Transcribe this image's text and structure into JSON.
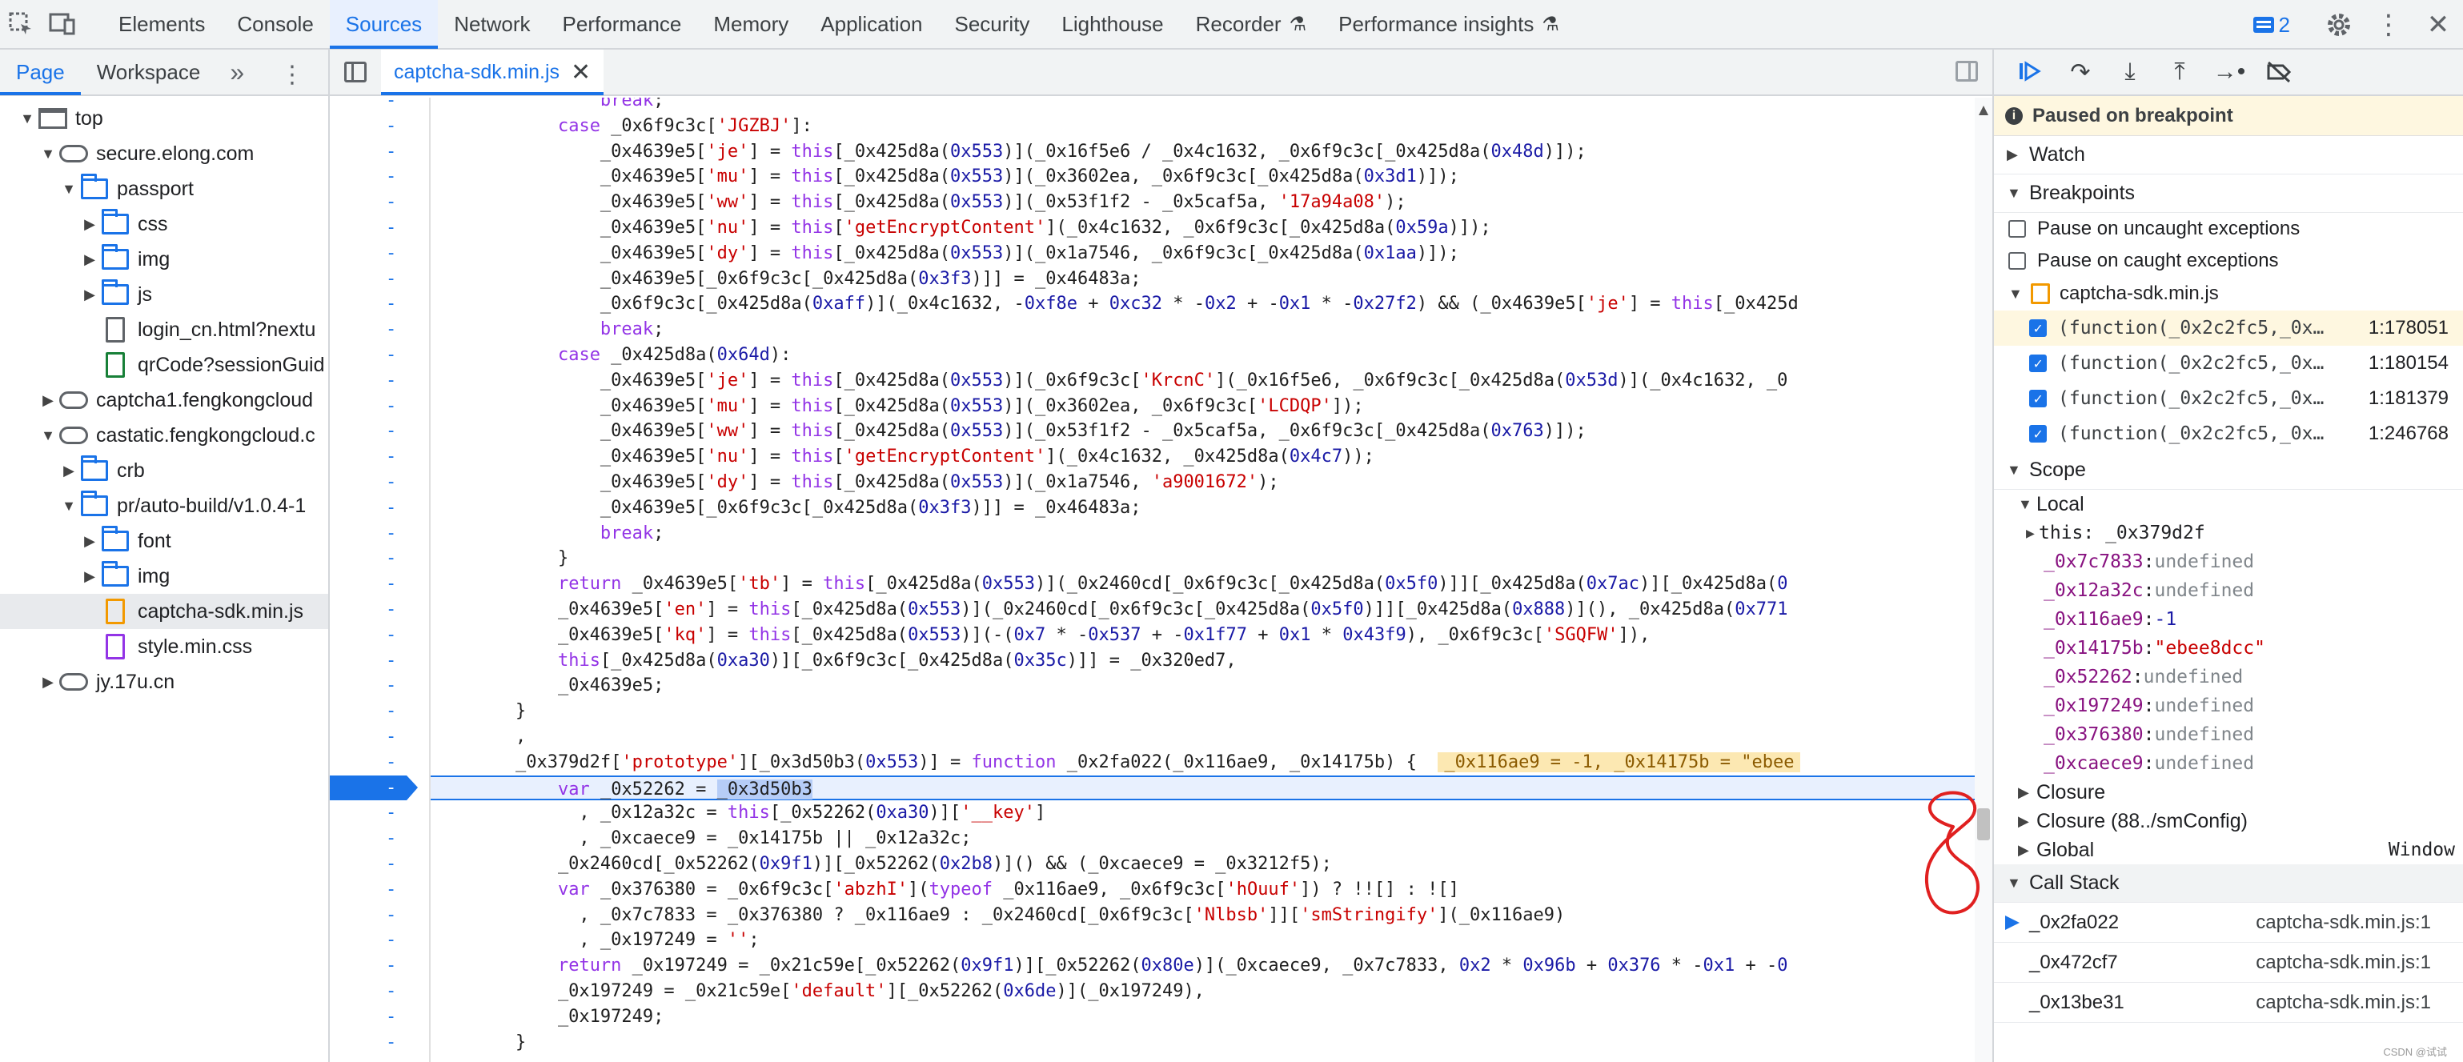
{
  "toolbar": {
    "tabs": [
      "Elements",
      "Console",
      "Sources",
      "Network",
      "Performance",
      "Memory",
      "Application",
      "Security",
      "Lighthouse",
      "Recorder",
      "Performance insights"
    ],
    "active_tab": "Sources",
    "issues_count": "2"
  },
  "navigator": {
    "tabs": [
      "Page",
      "Workspace"
    ],
    "tree": [
      {
        "label": "top",
        "icon": "frame"
      },
      {
        "label": "secure.elong.com",
        "icon": "cloud"
      },
      {
        "label": "passport",
        "icon": "folder"
      },
      {
        "label": "css",
        "icon": "folder"
      },
      {
        "label": "img",
        "icon": "folder"
      },
      {
        "label": "js",
        "icon": "folder"
      },
      {
        "label": "login_cn.html?nextu",
        "icon": "file"
      },
      {
        "label": "qrCode?sessionGuid",
        "icon": "file-green"
      },
      {
        "label": "captcha1.fengkongcloud",
        "icon": "cloud"
      },
      {
        "label": "castatic.fengkongcloud.c",
        "icon": "cloud"
      },
      {
        "label": "crb",
        "icon": "folder"
      },
      {
        "label": "pr/auto-build/v1.0.4-1",
        "icon": "folder"
      },
      {
        "label": "font",
        "icon": "folder"
      },
      {
        "label": "img",
        "icon": "folder"
      },
      {
        "label": "captcha-sdk.min.js",
        "icon": "file-orange"
      },
      {
        "label": "style.min.css",
        "icon": "file-purple"
      },
      {
        "label": "jy.17u.cn",
        "icon": "cloud"
      }
    ]
  },
  "editor": {
    "file_tab": "captcha-sdk.min.js",
    "gutter_marker": "-",
    "lines": [
      "                break;",
      "            case _0x6f9c3c['JGZBJ']:",
      "                _0x4639e5['je'] = this[_0x425d8a(0x553)](_0x16f5e6 / _0x4c1632, _0x6f9c3c[_0x425d8a(0x48d)]);",
      "                _0x4639e5['mu'] = this[_0x425d8a(0x553)](_0x3602ea, _0x6f9c3c[_0x425d8a(0x3d1)]);",
      "                _0x4639e5['ww'] = this[_0x425d8a(0x553)](_0x53f1f2 - _0x5caf5a, '17a94a08');",
      "                _0x4639e5['nu'] = this['getEncryptContent'](_0x4c1632, _0x6f9c3c[_0x425d8a(0x59a)]);",
      "                _0x4639e5['dy'] = this[_0x425d8a(0x553)](_0x1a7546, _0x6f9c3c[_0x425d8a(0x1aa)]);",
      "                _0x4639e5[_0x6f9c3c[_0x425d8a(0x3f3)]] = _0x46483a;",
      "                _0x6f9c3c[_0x425d8a(0xaff)](_0x4c1632, -0xf8e + 0xc32 * -0x2 + -0x1 * -0x27f2) && (_0x4639e5['je'] = this[_0x425d",
      "                break;",
      "            case _0x425d8a(0x64d):",
      "                _0x4639e5['je'] = this[_0x425d8a(0x553)](_0x6f9c3c['KrcnC'](_0x16f5e6, _0x6f9c3c[_0x425d8a(0x53d)](_0x4c1632, _0",
      "                _0x4639e5['mu'] = this[_0x425d8a(0x553)](_0x3602ea, _0x6f9c3c['LCDQP']);",
      "                _0x4639e5['ww'] = this[_0x425d8a(0x553)](_0x53f1f2 - _0x5caf5a, _0x6f9c3c[_0x425d8a(0x763)]);",
      "                _0x4639e5['nu'] = this['getEncryptContent'](_0x4c1632, _0x425d8a(0x4c7));",
      "                _0x4639e5['dy'] = this[_0x425d8a(0x553)](_0x1a7546, 'a9001672');",
      "                _0x4639e5[_0x6f9c3c[_0x425d8a(0x3f3)]] = _0x46483a;",
      "                break;",
      "            }",
      "            return _0x4639e5['tb'] = this[_0x425d8a(0x553)](_0x2460cd[_0x6f9c3c[_0x425d8a(0x5f0)]][_0x425d8a(0x7ac)][_0x425d8a(0",
      "            _0x4639e5['en'] = this[_0x425d8a(0x553)](_0x2460cd[_0x6f9c3c[_0x425d8a(0x5f0)]][_0x425d8a(0x888)](), _0x425d8a(0x771",
      "            _0x4639e5['kq'] = this[_0x425d8a(0x553)](-(0x7 * -0x537 + -0x1f77 + 0x1 * 0x43f9), _0x6f9c3c['SGQFW']),",
      "            this[_0x425d8a(0xa30)][_0x6f9c3c[_0x425d8a(0x35c)]] = _0x320ed7,",
      "            _0x4639e5;",
      "        }",
      "        ,",
      "        _0x379d2f['prototype'][_0x3d50b3(0x553)] = function _0x2fa022(_0x116ae9, _0x14175b) {",
      "            var _0x52262 = _0x3d50b3",
      "              , _0x12a32c = this[_0x52262(0xa30)]['__key']",
      "              , _0xcaece9 = _0x14175b || _0x12a32c;",
      "            _0x2460cd[_0x52262(0x9f1)][_0x52262(0x2b8)]() && (_0xcaece9 = _0x3212f5);",
      "            var _0x376380 = _0x6f9c3c['abzhI'](typeof _0x116ae9, _0x6f9c3c['hOuuf']) ? !![] : ![]",
      "              , _0x7c7833 = _0x376380 ? _0x116ae9 : _0x2460cd[_0x6f9c3c['Nlbsb']]['smStringify'](_0x116ae9)",
      "              , _0x197249 = '';",
      "            return _0x197249 = _0x21c59e[_0x52262(0x9f1)][_0x52262(0x80e)](_0xcaece9, _0x7c7833, 0x2 * 0x96b + 0x376 * -0x1 + -0",
      "            _0x197249 = _0x21c59e['default'][_0x52262(0x6de)](_0x197249),",
      "            _0x197249;",
      "        }"
    ],
    "inline_value": "_0x116ae9 = -1, _0x14175b = \"ebee",
    "selected_token": "_0x3d50b3"
  },
  "debugger": {
    "paused_message": "Paused on breakpoint",
    "watch_label": "Watch",
    "breakpoints_label": "Breakpoints",
    "pause_uncaught": "Pause on uncaught exceptions",
    "pause_caught": "Pause on caught exceptions",
    "bp_file": "captcha-sdk.min.js",
    "breakpoints": [
      {
        "code": "(function(_0x2c2fc5,_0x…",
        "loc": "1:178051"
      },
      {
        "code": "(function(_0x2c2fc5,_0x…",
        "loc": "1:180154"
      },
      {
        "code": "(function(_0x2c2fc5,_0x…",
        "loc": "1:181379"
      },
      {
        "code": "(function(_0x2c2fc5,_0x…",
        "loc": "1:246768"
      }
    ],
    "scope_label": "Scope",
    "local_label": "Local",
    "this_line": "this: _0x379d2f",
    "locals": [
      {
        "name": "_0x7c7833",
        "value": "undefined",
        "kind": "u"
      },
      {
        "name": "_0x12a32c",
        "value": "undefined",
        "kind": "u"
      },
      {
        "name": "_0x116ae9",
        "value": "-1",
        "kind": "n"
      },
      {
        "name": "_0x14175b",
        "value": "\"ebee8dcc\"",
        "kind": "s"
      },
      {
        "name": "_0x52262",
        "value": "undefined",
        "kind": "u"
      },
      {
        "name": "_0x197249",
        "value": "undefined",
        "kind": "u"
      },
      {
        "name": "_0x376380",
        "value": "undefined",
        "kind": "u"
      },
      {
        "name": "_0xcaece9",
        "value": "undefined",
        "kind": "u"
      }
    ],
    "closure_label": "Closure",
    "closure2_label": "Closure (88../smConfig)",
    "global_label": "Global",
    "global_value": "Window",
    "callstack_label": "Call Stack",
    "callstack": [
      {
        "fn": "_0x2fa022",
        "loc": "captcha-sdk.min.js:1"
      },
      {
        "fn": "_0x472cf7",
        "loc": "captcha-sdk.min.js:1"
      },
      {
        "fn": "_0x13be31",
        "loc": "captcha-sdk.min.js:1"
      }
    ],
    "watermark": "CSDN @试试"
  },
  "colors": {
    "accent": "#1a73e8",
    "paused_bg": "#fef7e0",
    "annotation": "#e02020"
  }
}
